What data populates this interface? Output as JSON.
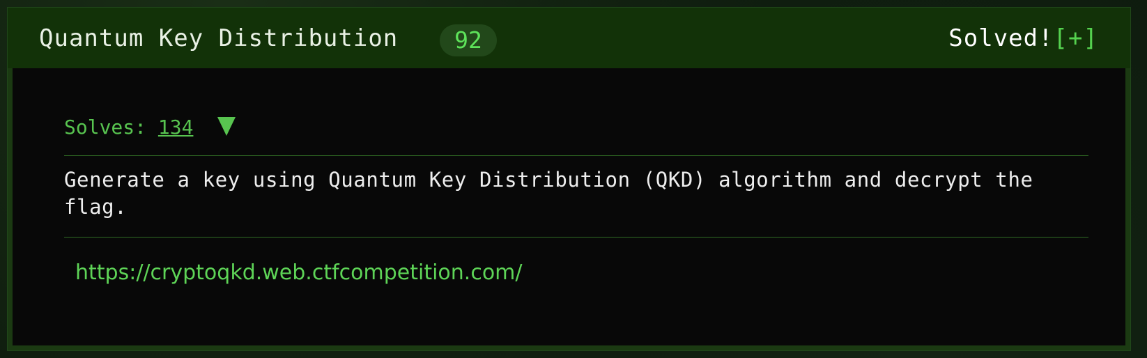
{
  "challenge": {
    "title": "Quantum Key Distribution",
    "points": "92",
    "status": "Solved!",
    "toggle_label": "[+]",
    "solves_label": "Solves:",
    "solves_count": "134",
    "description": "Generate a key using Quantum Key Distribution (QKD) algorithm and decrypt the flag.",
    "link": "https://cryptoqkd.web.ctfcompetition.com/"
  },
  "colors": {
    "header_bg": "#123208",
    "body_bg": "#080808",
    "accent_green": "#58c450",
    "points_pill_bg": "#22481a"
  }
}
